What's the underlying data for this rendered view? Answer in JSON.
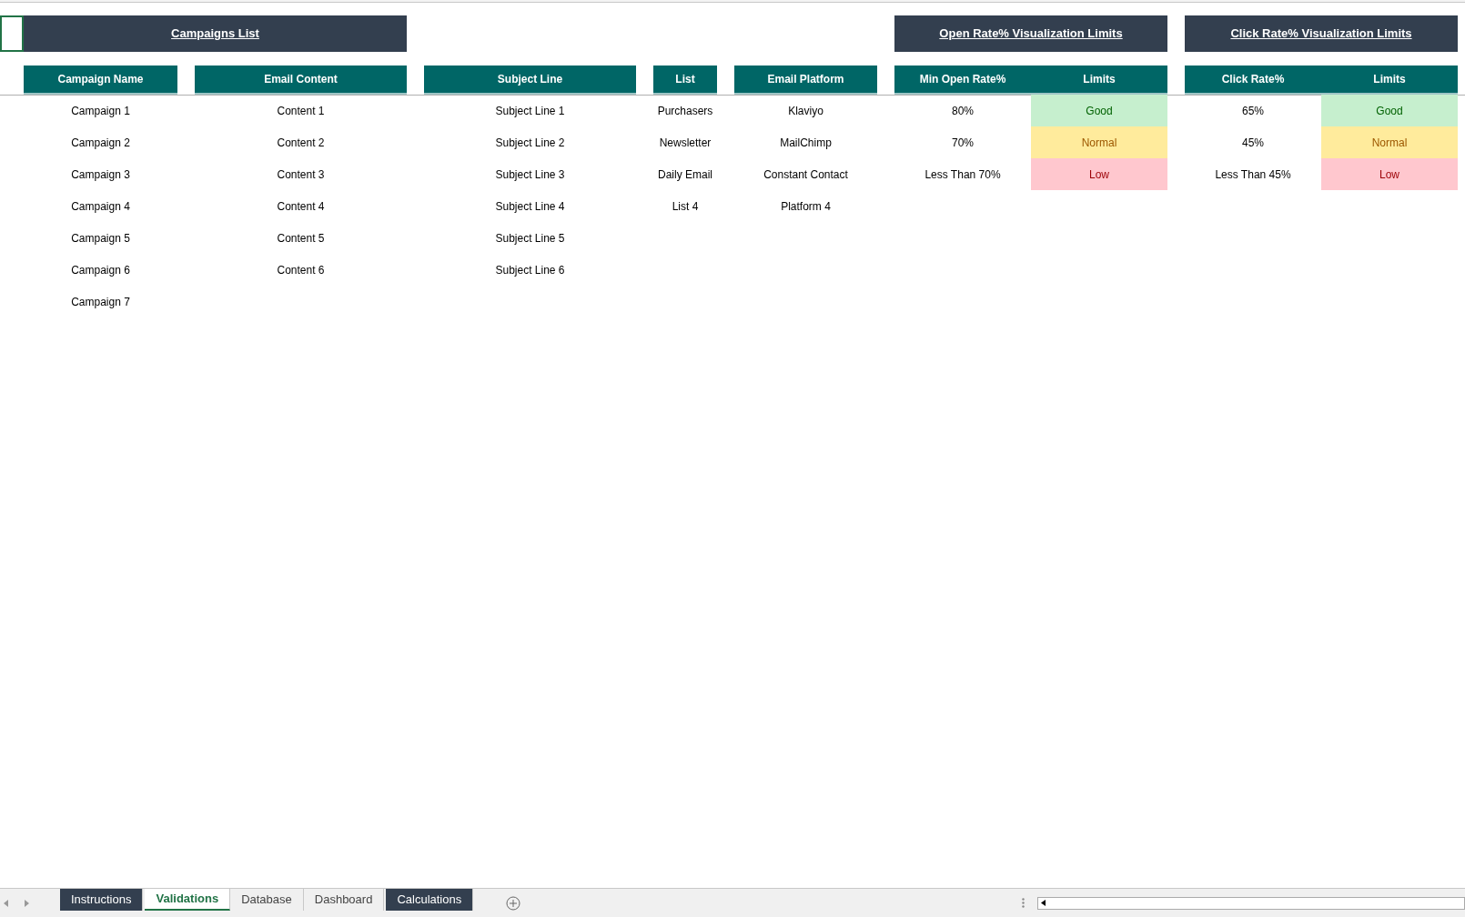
{
  "campaigns_title": "Campaigns List",
  "open_rate_title": "Open Rate% Visualization Limits",
  "click_rate_title": "Click Rate% Visualization Limits",
  "columns": [
    {
      "header": "Campaign Name",
      "cells": [
        "Campaign 1",
        "Campaign 2",
        "Campaign 3",
        "Campaign 4",
        "Campaign 5",
        "Campaign 6",
        "Campaign 7"
      ]
    },
    {
      "header": "Email Content",
      "cells": [
        "Content 1",
        "Content 2",
        "Content 3",
        "Content 4",
        "Content 5",
        "Content 6"
      ]
    },
    {
      "header": "Subject Line",
      "cells": [
        "Subject Line 1",
        "Subject Line 2",
        "Subject Line 3",
        "Subject Line 4",
        "Subject Line 5",
        "Subject Line 6"
      ]
    },
    {
      "header": "List",
      "cells": [
        "Purchasers",
        "Newsletter",
        "Daily Email",
        "List 4"
      ]
    },
    {
      "header": "Email Platform",
      "cells": [
        "Klaviyo",
        "MailChimp",
        "Constant Contact",
        "Platform 4"
      ]
    }
  ],
  "open_rate": {
    "headers": [
      "Min Open Rate%",
      "Limits"
    ],
    "rows": [
      {
        "value": "80%",
        "limit": "Good",
        "kind": "good"
      },
      {
        "value": "70%",
        "limit": "Normal",
        "kind": "normal"
      },
      {
        "value": "Less Than 70%",
        "limit": "Low",
        "kind": "low"
      }
    ]
  },
  "click_rate": {
    "headers": [
      "Click Rate%",
      "Limits"
    ],
    "rows": [
      {
        "value": "65%",
        "limit": "Good",
        "kind": "good"
      },
      {
        "value": "45%",
        "limit": "Normal",
        "kind": "normal"
      },
      {
        "value": "Less Than 45%",
        "limit": "Low",
        "kind": "low"
      }
    ]
  },
  "sheet_tabs": [
    {
      "label": "Instructions",
      "selected": false,
      "color": "#333f4f"
    },
    {
      "label": "Validations",
      "selected": true
    },
    {
      "label": "Database",
      "selected": false
    },
    {
      "label": "Dashboard",
      "selected": false
    },
    {
      "label": "Calculations",
      "selected": false,
      "color": "#333f4f"
    }
  ]
}
